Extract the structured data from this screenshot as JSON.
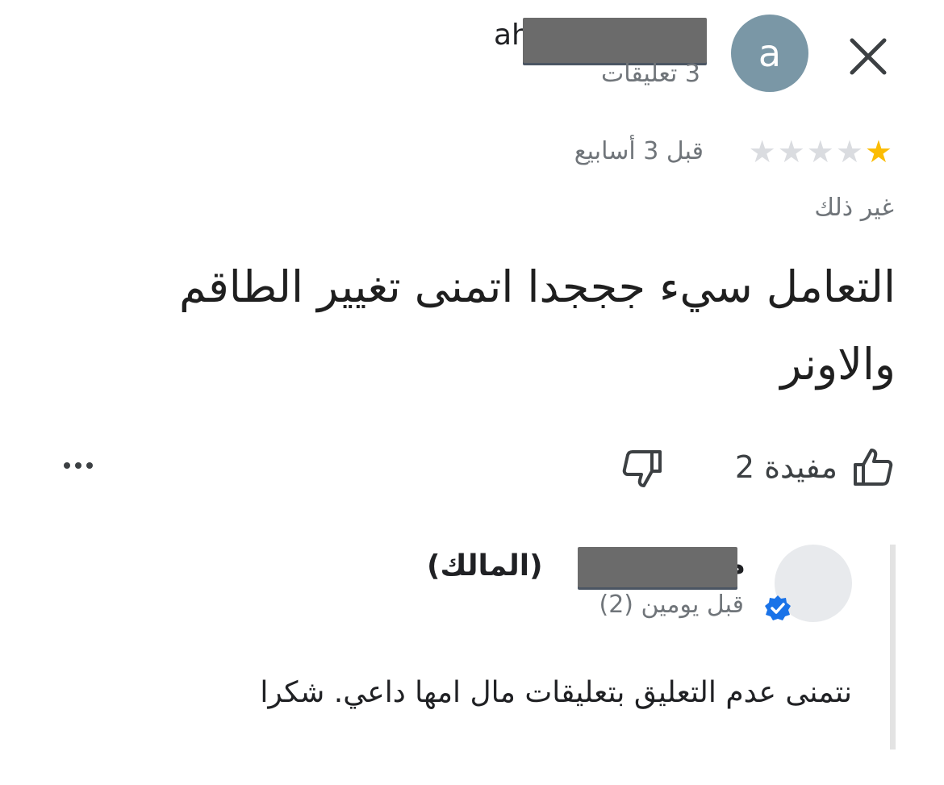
{
  "reviewer": {
    "avatar_letter": "a",
    "name_visible": "ah",
    "review_count": "3 تعليقات"
  },
  "review": {
    "rating": 1,
    "max_rating": 5,
    "stars_filled": "★",
    "stars_empty": "★★★★",
    "date": "قبل 3 أسابيع",
    "category": "غير ذلك",
    "text": "التعامل سيء جججدا اتمنى تغيير الطاقم والاونر",
    "helpful_label": "مفيدة 2"
  },
  "owner_reply": {
    "name_suffix": "(المالك)",
    "name_prefix": "م",
    "date": "قبل يومين (2)",
    "text": "نتمنى عدم التعليق بتعليقات مال امها داعي. شكرا"
  },
  "icons": {
    "close": "close-icon",
    "thumbs_up": "thumbs-up-icon",
    "thumbs_down": "thumbs-down-icon",
    "more": "more-horizontal-icon",
    "verified": "verified-badge-icon"
  },
  "colors": {
    "star_filled": "#fbbc04",
    "star_empty": "#dadce0",
    "avatar_bg": "#7a97a6",
    "verified_blue": "#1a73e8"
  }
}
